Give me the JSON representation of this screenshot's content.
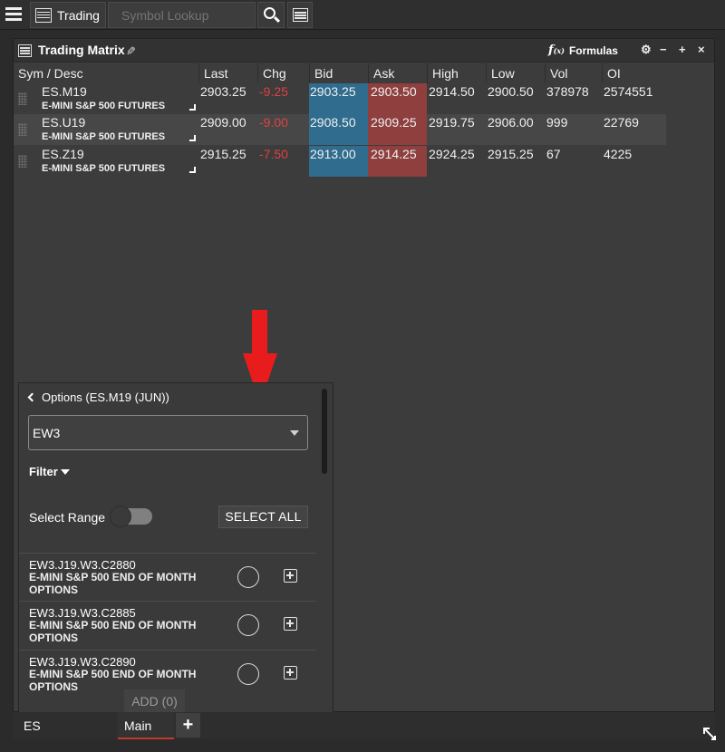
{
  "topbar": {
    "menu_icon": "hamburger-menu-icon",
    "trading_tab_label": "Trading",
    "symbol_lookup_placeholder": "Symbol Lookup",
    "search_icon": "search-icon",
    "new_window_icon": "window-grid-icon"
  },
  "window": {
    "title": "Trading Matrix",
    "formulas_label": "Formulas",
    "controls": [
      "gear-icon",
      "minimize-icon",
      "maximize-icon",
      "close-icon"
    ]
  },
  "table": {
    "headers": [
      "Sym / Desc",
      "Last",
      "Chg",
      "Bid",
      "Ask",
      "High",
      "Low",
      "Vol",
      "OI"
    ],
    "rows": [
      {
        "symbol": "ES.M19",
        "desc": "E-MINI S&P 500 FUTURES",
        "last": "2903.25",
        "chg": "-9.25",
        "bid": "2903.25",
        "ask": "2903.50",
        "high": "2914.50",
        "low": "2900.50",
        "vol": "378978",
        "oi": "2574551"
      },
      {
        "symbol": "ES.U19",
        "desc": "E-MINI S&P 500 FUTURES",
        "last": "2909.00",
        "chg": "-9.00",
        "bid": "2908.50",
        "ask": "2909.25",
        "high": "2919.75",
        "low": "2906.00",
        "vol": "999",
        "oi": "22769"
      },
      {
        "symbol": "ES.Z19",
        "desc": "E-MINI S&P 500 FUTURES",
        "last": "2915.25",
        "chg": "-7.50",
        "bid": "2913.00",
        "ask": "2914.25",
        "high": "2924.25",
        "low": "2915.25",
        "vol": "67",
        "oi": "4225"
      }
    ]
  },
  "options_panel": {
    "back_label": "Options (ES.M19 (JUN))",
    "selected_root": "EW3",
    "filter_label": "Filter",
    "select_range_label": "Select Range",
    "select_range_on": false,
    "select_all_label": "SELECT ALL",
    "items": [
      {
        "code": "EW3.J19.W3.C2880",
        "desc": "E-MINI S&P 500 END OF MONTH OPTIONS"
      },
      {
        "code": "EW3.J19.W3.C2885",
        "desc": "E-MINI S&P 500 END OF MONTH OPTIONS"
      },
      {
        "code": "EW3.J19.W3.C2890",
        "desc": "E-MINI S&P 500 END OF MONTH OPTIONS"
      }
    ],
    "add_label": "ADD (0)"
  },
  "bottom_tabs": {
    "tabs": [
      "ES",
      "Main"
    ],
    "active": "Main"
  },
  "colors": {
    "bid_bg": "#2f6c8e",
    "ask_bg": "#8e3f3e",
    "negative": "#e14040",
    "annotation_arrow": "#e81c1c"
  }
}
